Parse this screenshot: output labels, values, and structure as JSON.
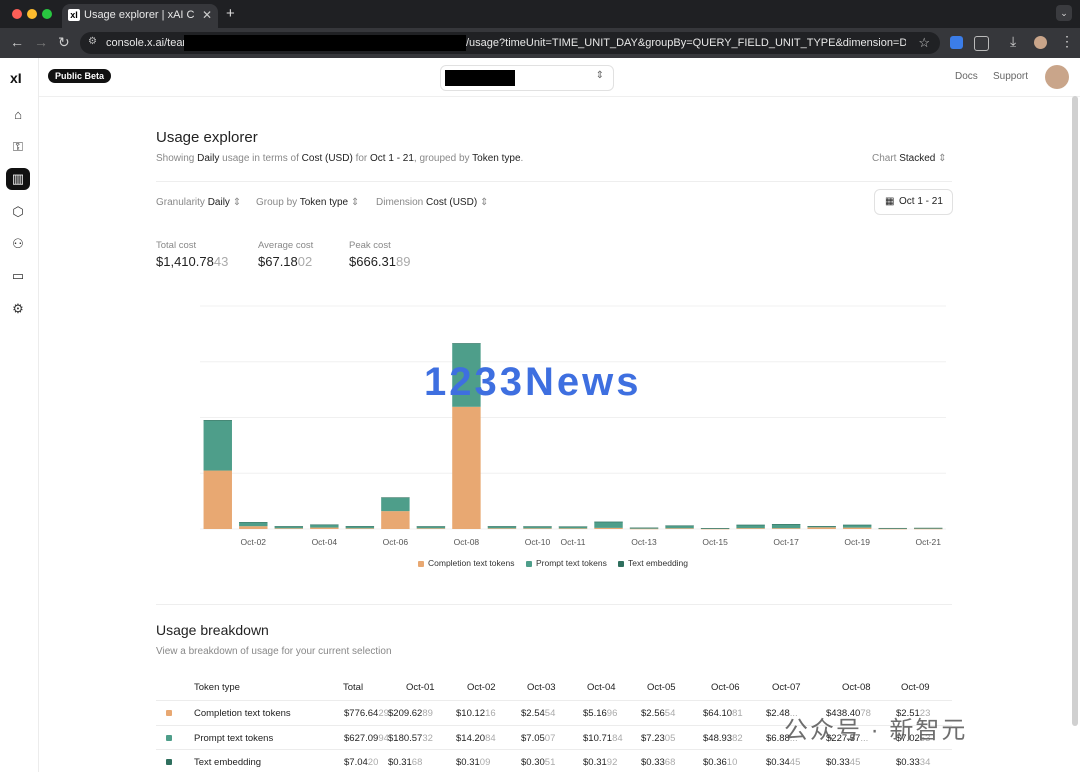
{
  "browser": {
    "tab_title": "Usage explorer | xAI Cloud Co",
    "tab_favicon": "xI",
    "url_prefix": "console.x.ai/team/",
    "url_suffix": "/usage?timeUnit=TIME_UNIT_DAY&groupBy=QUERY_FIELD_UNIT_TYPE&dimension=DIMENSION_USD&timezone=..."
  },
  "sidebar": {
    "logo": "xI",
    "items": [
      {
        "name": "home",
        "glyph": "⌂"
      },
      {
        "name": "api-keys",
        "glyph": "⚿"
      },
      {
        "name": "usage",
        "glyph": "▥"
      },
      {
        "name": "models",
        "glyph": "⬡"
      },
      {
        "name": "team",
        "glyph": "⚇"
      },
      {
        "name": "billing",
        "glyph": "▭"
      },
      {
        "name": "settings",
        "glyph": "⚙"
      }
    ]
  },
  "topbar": {
    "badge": "Public Beta",
    "docs": "Docs",
    "support": "Support"
  },
  "header": {
    "title": "Usage explorer",
    "sub_1": "Showing",
    "sub_granularity": "Daily",
    "sub_2": "usage in terms of",
    "sub_dimension": "Cost (USD)",
    "sub_3": "for",
    "sub_range": "Oct 1 - 21",
    "sub_4": ", grouped by",
    "sub_group": "Token type",
    "sub_5": ".",
    "chart_label": "Chart",
    "chart_value": "Stacked"
  },
  "filters": {
    "granularity_label": "Granularity",
    "granularity_value": "Daily",
    "groupby_label": "Group by",
    "groupby_value": "Token type",
    "dimension_label": "Dimension",
    "dimension_value": "Cost (USD)",
    "date_range": "Oct 1 - 21"
  },
  "stats": {
    "total_label": "Total cost",
    "total_main": "$1,410.78",
    "total_dim": "43",
    "average_label": "Average cost",
    "average_main": "$67.18",
    "average_dim": "02",
    "peak_label": "Peak cost",
    "peak_main": "$666.31",
    "peak_dim": "89"
  },
  "chart_data": {
    "type": "bar",
    "stacked": true,
    "categories": [
      "Oct-01",
      "Oct-02",
      "Oct-03",
      "Oct-04",
      "Oct-05",
      "Oct-06",
      "Oct-07",
      "Oct-08",
      "Oct-09",
      "Oct-10",
      "Oct-11",
      "Oct-12",
      "Oct-13",
      "Oct-14",
      "Oct-15",
      "Oct-16",
      "Oct-17",
      "Oct-18",
      "Oct-19",
      "Oct-20",
      "Oct-21"
    ],
    "tick_labels": [
      "",
      "Oct-02",
      "",
      "Oct-04",
      "",
      "Oct-06",
      "",
      "Oct-08",
      "",
      "Oct-10",
      "Oct-11",
      "",
      "Oct-13",
      "",
      "Oct-15",
      "",
      "Oct-17",
      "",
      "Oct-19",
      "",
      "Oct-21"
    ],
    "series": [
      {
        "name": "Completion text tokens",
        "color": "#e8a872",
        "values": [
          209.63,
          10.12,
          2.55,
          5.17,
          2.57,
          64.11,
          2.49,
          438.41,
          2.51,
          2.4,
          2.3,
          4.0,
          1.2,
          2.6,
          1.0,
          3.0,
          2.8,
          6.0,
          5.0,
          1.0,
          1.2
        ]
      },
      {
        "name": "Prompt text tokens",
        "color": "#4e9e8a",
        "values": [
          180.57,
          14.21,
          7.05,
          10.72,
          7.23,
          48.94,
          6.89,
          227.57,
          7.04,
          6.8,
          6.6,
          22.0,
          3.4,
          9.8,
          2.0,
          12.0,
          14.5,
          4.0,
          10.0,
          2.4,
          2.7
        ]
      },
      {
        "name": "Text embedding",
        "color": "#2f6f5e",
        "values": [
          0.32,
          0.31,
          0.31,
          0.32,
          0.34,
          0.36,
          0.34,
          0.33,
          0.33,
          0.3,
          0.3,
          0.3,
          0.3,
          0.3,
          0.3,
          0.3,
          0.3,
          0.3,
          0.3,
          0.3,
          0.3
        ]
      }
    ],
    "ylim": [
      0,
      800
    ],
    "grid": true,
    "legend": "bottom-center"
  },
  "watermark": "1233News",
  "watermark2": "公众号 · 新智元",
  "breakdown": {
    "title": "Usage breakdown",
    "subtitle": "View a breakdown of usage for your current selection",
    "columns": [
      "Token type",
      "Total",
      "Oct-01",
      "Oct-02",
      "Oct-03",
      "Oct-04",
      "Oct-05",
      "Oct-06",
      "Oct-07",
      "Oct-08",
      "Oct-09"
    ],
    "rows": [
      {
        "type": "Completion text tokens",
        "color": "#e8a872",
        "cells": [
          [
            "$776.64",
            "29"
          ],
          [
            "$209.62",
            "89"
          ],
          [
            "$10.12",
            "16"
          ],
          [
            "$2.54",
            "54"
          ],
          [
            "$5.16",
            "96"
          ],
          [
            "$2.56",
            "54"
          ],
          [
            "$64.10",
            "81"
          ],
          [
            "$2.48",
            "..."
          ],
          [
            "$438.40",
            "78"
          ],
          [
            "$2.51",
            "23"
          ]
        ]
      },
      {
        "type": "Prompt text tokens",
        "color": "#4e9e8a",
        "cells": [
          [
            "$627.09",
            "94"
          ],
          [
            "$180.57",
            "32"
          ],
          [
            "$14.20",
            "84"
          ],
          [
            "$7.05",
            "07"
          ],
          [
            "$10.71",
            "84"
          ],
          [
            "$7.23",
            "05"
          ],
          [
            "$48.93",
            "82"
          ],
          [
            "$6.88",
            "..."
          ],
          [
            "$227.57",
            "..."
          ],
          [
            "$7.02",
            "53"
          ]
        ]
      },
      {
        "type": "Text embedding",
        "color": "#2f6f5e",
        "cells": [
          [
            "$7.04",
            "20"
          ],
          [
            "$0.31",
            "68"
          ],
          [
            "$0.31",
            "09"
          ],
          [
            "$0.30",
            "51"
          ],
          [
            "$0.31",
            "92"
          ],
          [
            "$0.33",
            "68"
          ],
          [
            "$0.36",
            "10"
          ],
          [
            "$0.34",
            "45"
          ],
          [
            "$0.33",
            "45"
          ],
          [
            "$0.33",
            "34"
          ]
        ]
      }
    ]
  }
}
